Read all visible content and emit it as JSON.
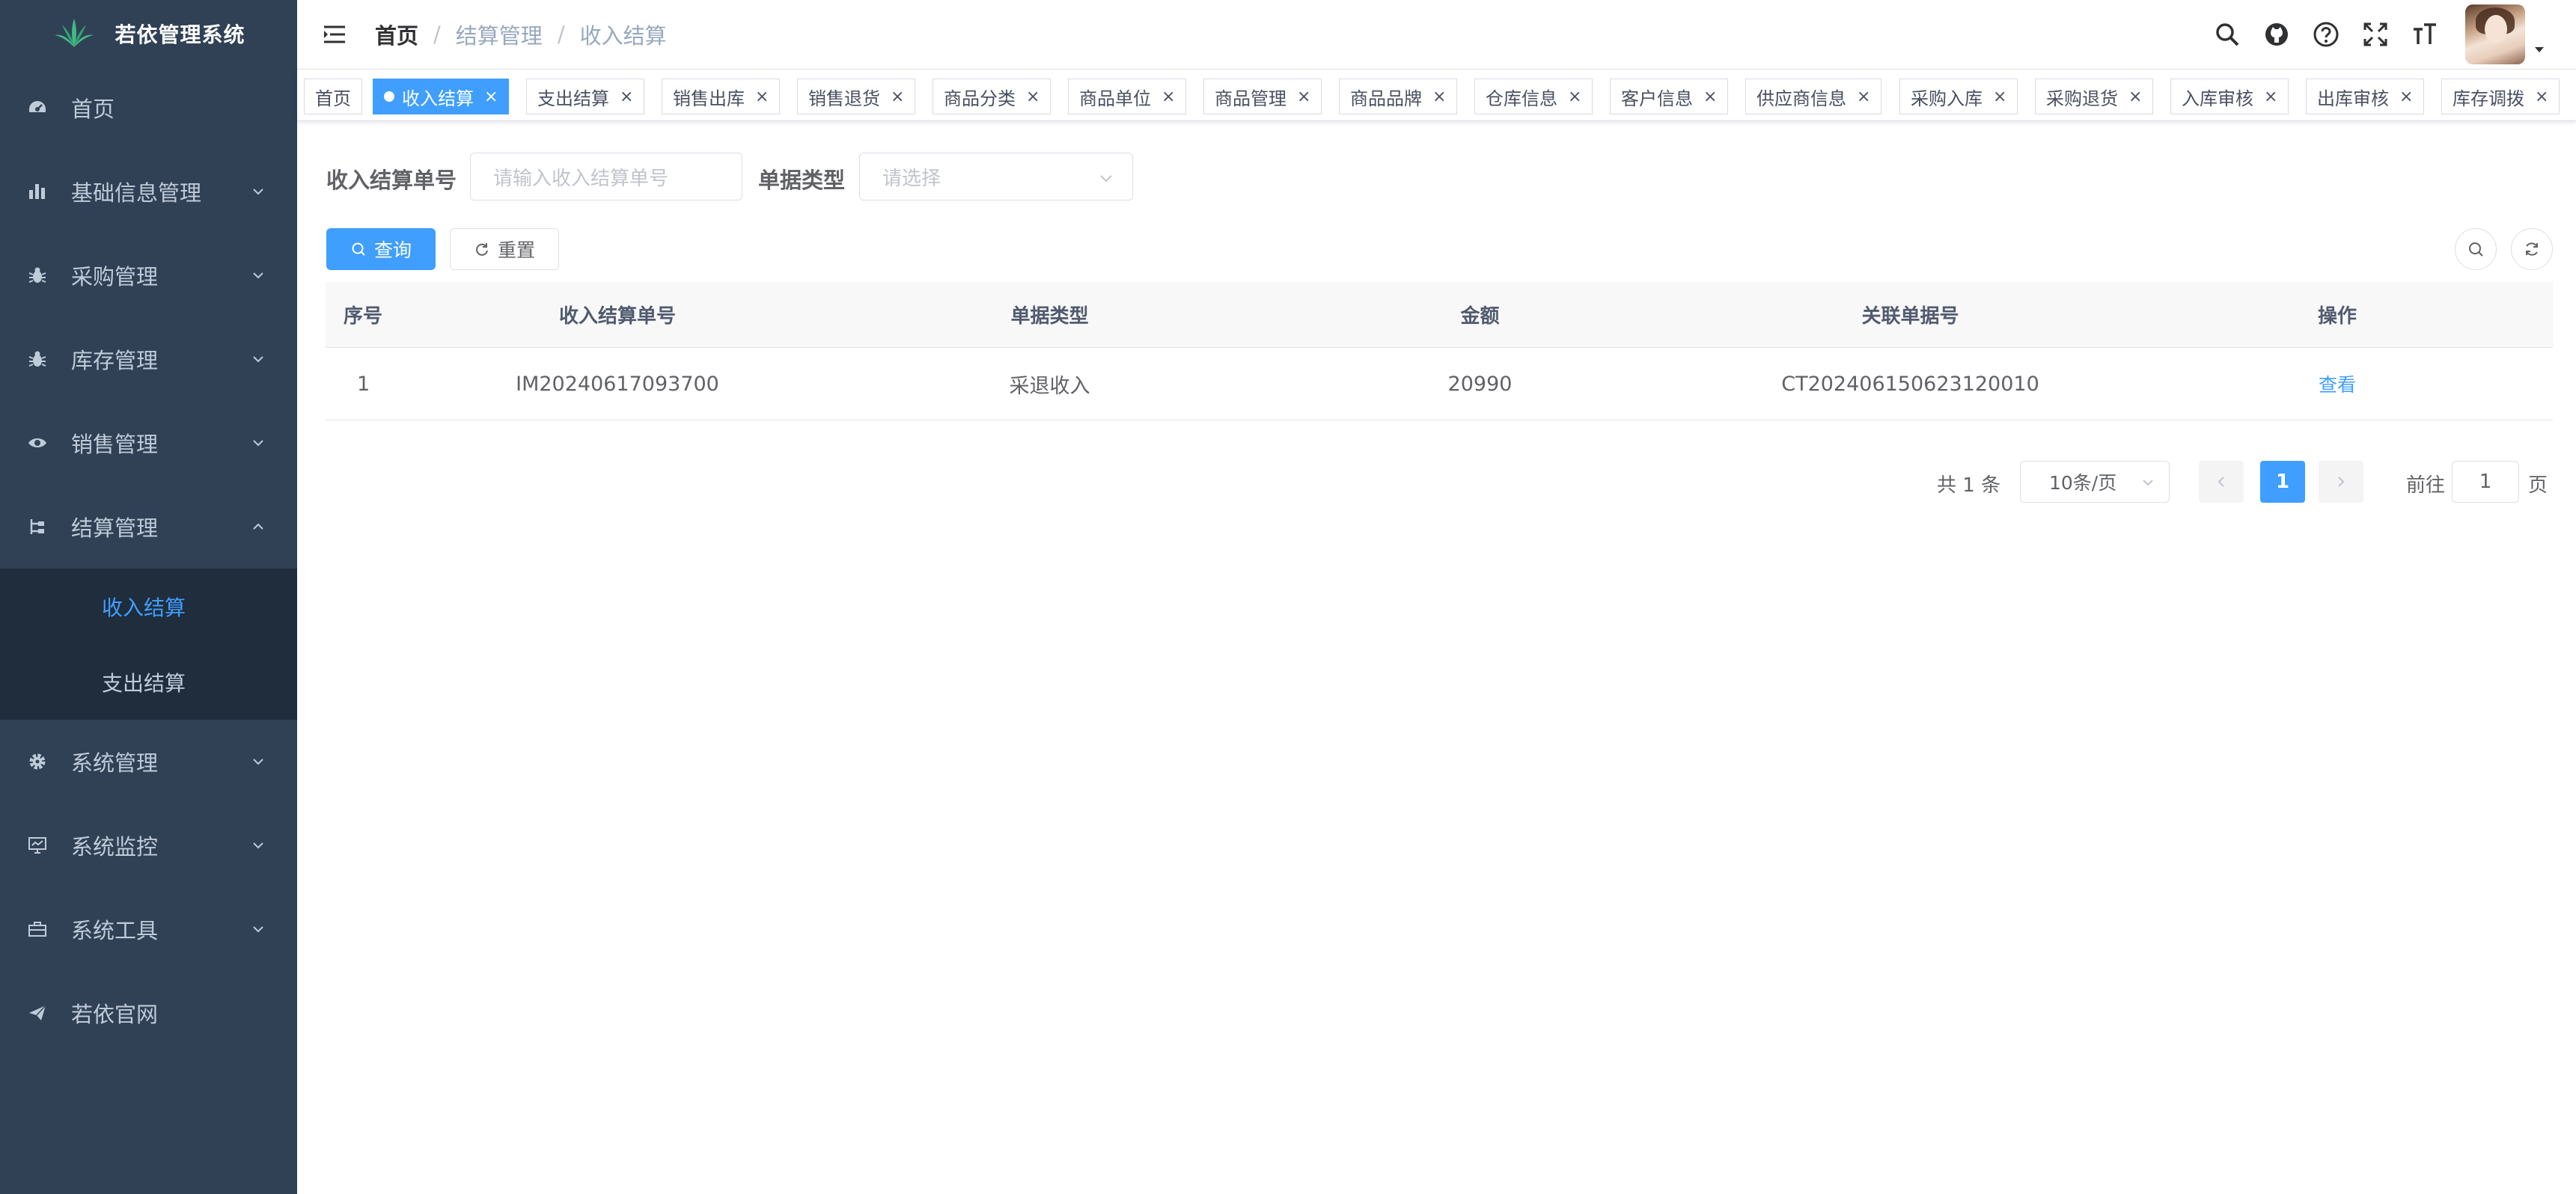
{
  "app": {
    "title": "若依管理系统"
  },
  "sidebar": {
    "items": [
      {
        "label": "首页",
        "icon": "dashboard-icon"
      },
      {
        "label": "基础信息管理",
        "icon": "chart-bar-icon"
      },
      {
        "label": "采购管理",
        "icon": "bug-icon"
      },
      {
        "label": "库存管理",
        "icon": "bug-icon"
      },
      {
        "label": "销售管理",
        "icon": "eye-icon"
      },
      {
        "label": "结算管理",
        "icon": "tree-icon",
        "expanded": true
      },
      {
        "label": "系统管理",
        "icon": "gear-icon"
      },
      {
        "label": "系统监控",
        "icon": "monitor-icon"
      },
      {
        "label": "系统工具",
        "icon": "toolbox-icon"
      },
      {
        "label": "若依官网",
        "icon": "paper-plane-icon"
      }
    ],
    "submenu": [
      {
        "label": "收入结算",
        "active": true
      },
      {
        "label": "支出结算",
        "active": false
      }
    ]
  },
  "breadcrumb": {
    "home": "首页",
    "level1": "结算管理",
    "level2": "收入结算"
  },
  "tags": [
    {
      "label": "首页",
      "active": false,
      "closable": false
    },
    {
      "label": "收入结算",
      "active": true,
      "closable": true
    },
    {
      "label": "支出结算",
      "active": false,
      "closable": true
    },
    {
      "label": "销售出库",
      "active": false,
      "closable": true
    },
    {
      "label": "销售退货",
      "active": false,
      "closable": true
    },
    {
      "label": "商品分类",
      "active": false,
      "closable": true
    },
    {
      "label": "商品单位",
      "active": false,
      "closable": true
    },
    {
      "label": "商品管理",
      "active": false,
      "closable": true
    },
    {
      "label": "商品品牌",
      "active": false,
      "closable": true
    },
    {
      "label": "仓库信息",
      "active": false,
      "closable": true
    },
    {
      "label": "客户信息",
      "active": false,
      "closable": true
    },
    {
      "label": "供应商信息",
      "active": false,
      "closable": true
    },
    {
      "label": "采购入库",
      "active": false,
      "closable": true
    },
    {
      "label": "采购退货",
      "active": false,
      "closable": true
    },
    {
      "label": "入库审核",
      "active": false,
      "closable": true
    },
    {
      "label": "出库审核",
      "active": false,
      "closable": true
    },
    {
      "label": "库存调拨",
      "active": false,
      "closable": true
    }
  ],
  "tag_close_glyph": "×",
  "search": {
    "order_no_label": "收入结算单号",
    "order_no_placeholder": "请输入收入结算单号",
    "order_type_label": "单据类型",
    "order_type_placeholder": "请选择",
    "query_label": "查询",
    "reset_label": "重置"
  },
  "table": {
    "columns": [
      "序号",
      "收入结算单号",
      "单据类型",
      "金额",
      "关联单据号",
      "操作"
    ],
    "rows": [
      {
        "index": "1",
        "order_no": "IM20240617093700",
        "type": "采退收入",
        "amount": "20990",
        "related_no": "CT20240615062312001​0",
        "action": "查看"
      }
    ]
  },
  "pagination": {
    "total_text": "共 1 条",
    "page_size": "10条/页",
    "current_page": "1",
    "goto_label": "前往",
    "goto_value": "1",
    "page_suffix": "页"
  },
  "colors": {
    "sidebar_bg": "#304156",
    "submenu_bg": "#1f2d3d",
    "primary": "#409eff",
    "sidebar_text": "#bfcbd9"
  }
}
